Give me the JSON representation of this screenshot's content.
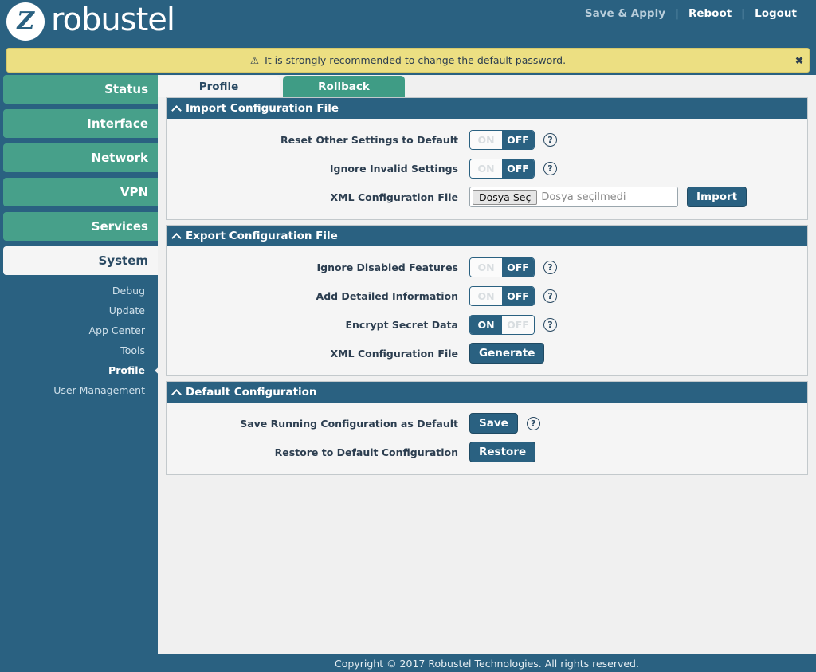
{
  "header": {
    "brand": "robustel",
    "logo_glyph": "Ζ",
    "links": [
      {
        "label": "Save & Apply",
        "state": "dim"
      },
      {
        "label": "Reboot",
        "state": "bright"
      },
      {
        "label": "Logout",
        "state": "bright"
      }
    ],
    "separator": "|"
  },
  "banner": {
    "icon": "warning-triangle-icon",
    "icon_glyph": "⚠",
    "message": "It is strongly recommended to change the default password.",
    "close_label": "✖",
    "background": "#ecdf82"
  },
  "sidebar": {
    "main_items": [
      {
        "label": "Status",
        "active": false
      },
      {
        "label": "Interface",
        "active": false
      },
      {
        "label": "Network",
        "active": false
      },
      {
        "label": "VPN",
        "active": false
      },
      {
        "label": "Services",
        "active": false
      },
      {
        "label": "System",
        "active": true
      }
    ],
    "sub_items": [
      {
        "label": "Debug",
        "active": false
      },
      {
        "label": "Update",
        "active": false
      },
      {
        "label": "App Center",
        "active": false
      },
      {
        "label": "Tools",
        "active": false
      },
      {
        "label": "Profile",
        "active": true
      },
      {
        "label": "User Management",
        "active": false
      }
    ],
    "accent": "#47a08a",
    "background": "#2a6181"
  },
  "tabs": [
    {
      "label": "Profile",
      "active": true
    },
    {
      "label": "Rollback",
      "active": false
    }
  ],
  "panels": [
    {
      "title": "Import Configuration File",
      "collapse_icon": "chevron-up-icon",
      "rows": [
        {
          "label": "Reset Other Settings to Default",
          "control": "toggle",
          "on_label": "ON",
          "off_label": "OFF",
          "value": "OFF",
          "help": true
        },
        {
          "label": "Ignore Invalid Settings",
          "control": "toggle",
          "on_label": "ON",
          "off_label": "OFF",
          "value": "OFF",
          "help": true
        },
        {
          "label": "XML Configuration File",
          "control": "file",
          "file_button": "Dosya Seç",
          "file_value": "Dosya seçilmedi",
          "action_button": "Import",
          "help": false
        }
      ]
    },
    {
      "title": "Export Configuration File",
      "collapse_icon": "chevron-up-icon",
      "rows": [
        {
          "label": "Ignore Disabled Features",
          "control": "toggle",
          "on_label": "ON",
          "off_label": "OFF",
          "value": "OFF",
          "help": true
        },
        {
          "label": "Add Detailed Information",
          "control": "toggle",
          "on_label": "ON",
          "off_label": "OFF",
          "value": "OFF",
          "help": true
        },
        {
          "label": "Encrypt Secret Data",
          "control": "toggle",
          "on_label": "ON",
          "off_label": "OFF",
          "value": "ON",
          "help": true
        },
        {
          "label": "XML Configuration File",
          "control": "button",
          "action_button": "Generate",
          "help": false
        }
      ]
    },
    {
      "title": "Default Configuration",
      "collapse_icon": "chevron-up-icon",
      "rows": [
        {
          "label": "Save Running Configuration as Default",
          "control": "button",
          "action_button": "Save",
          "help": true
        },
        {
          "label": "Restore to Default Configuration",
          "control": "button",
          "action_button": "Restore",
          "help": false
        }
      ]
    }
  ],
  "footer": {
    "text": "Copyright © 2017 Robustel Technologies. All rights reserved."
  },
  "colors": {
    "brand_blue": "#2a6181",
    "accent_green": "#47a08a",
    "tab_green": "#3f9c85",
    "warning_yellow": "#ecdf82",
    "content_bg": "#f0f0f0"
  }
}
